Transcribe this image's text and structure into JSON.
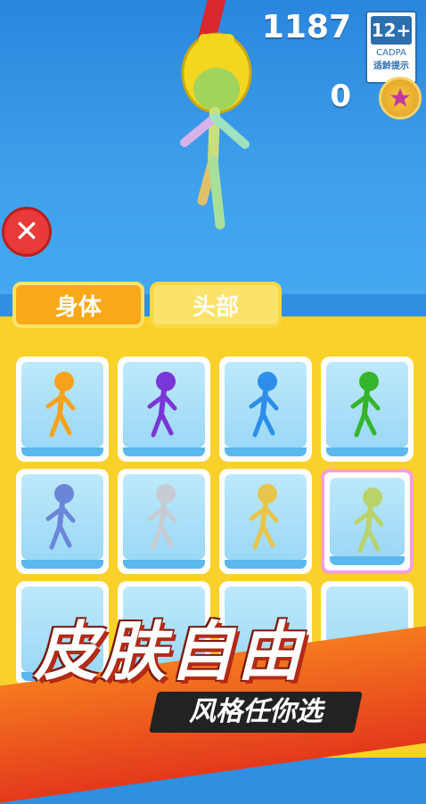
{
  "hud": {
    "score": "1187",
    "coins": "0"
  },
  "age_badge": {
    "rating": "12+",
    "org": "CADPA",
    "tip": "适龄提示"
  },
  "tabs": [
    {
      "label": "身体",
      "active": true
    },
    {
      "label": "头部",
      "active": false
    }
  ],
  "skins": [
    {
      "name": "orange",
      "color": "#f7a21d"
    },
    {
      "name": "purple",
      "color": "#7a36d6"
    },
    {
      "name": "blue",
      "color": "#2c8ee8"
    },
    {
      "name": "green",
      "color": "#35b52c"
    },
    {
      "name": "chrome-blue",
      "color": "#6a86d8"
    },
    {
      "name": "silver",
      "color": "#c7ccd3"
    },
    {
      "name": "gold",
      "color": "#e8c54a"
    },
    {
      "name": "holographic",
      "color": "#b9d36a",
      "selected": true
    }
  ],
  "banner": {
    "title": "皮肤自由",
    "subtitle": "风格任你选"
  },
  "colors": {
    "accent": "#f9a81a",
    "panel": "#f9d12a",
    "sky": "#3ea0ec"
  }
}
